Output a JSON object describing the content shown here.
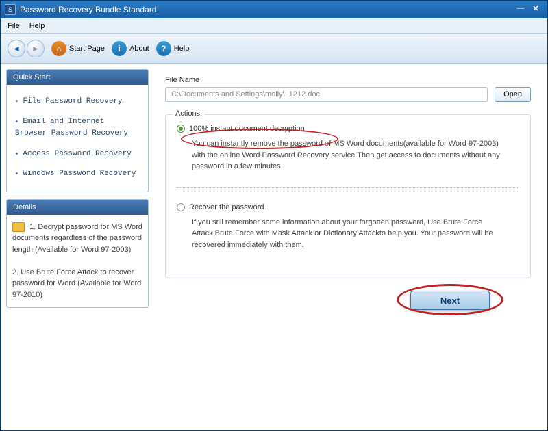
{
  "titlebar": {
    "title": "Password Recovery Bundle Standard",
    "icon_text": "S"
  },
  "menu": {
    "file": "File",
    "help": "Help"
  },
  "toolbar": {
    "back_glyph": "◄",
    "fwd_glyph": "►",
    "start_page": "Start Page",
    "about": "About",
    "help": "Help",
    "home_glyph": "⌂",
    "info_glyph": "i",
    "help_glyph": "?"
  },
  "sidebar": {
    "quick_start_title": "Quick Start",
    "items": [
      "File Password Recovery",
      "Email and Internet Browser Password Recovery",
      "Access Password Recovery",
      "Windows Password Recovery"
    ],
    "details_title": "Details",
    "details_text_1": "1. Decrypt password for MS Word documents regardless of the password length.(Available for Word 97-2003)",
    "details_text_2": "2. Use Brute Force Attack to recover password for Word (Available for Word 97-2010)"
  },
  "main": {
    "file_name_label": "File Name",
    "file_path": "C:\\Documents and Settings\\molly\\  1212.doc",
    "open_btn": "Open",
    "actions_label": "Actions:",
    "option1": {
      "label": "100% instant document decryption",
      "desc": "You can instantly remove the password of MS Word documents(available for Word 97-2003) with the online Word Password Recovery service.Then get access to documents without any password in a few minutes"
    },
    "option2": {
      "label": "Recover the password",
      "desc": "If you still remember some information about your forgotten password, Use Brute Force Attack,Brute Force with Mask Attack or Dictionary Attackto help you. Your password will be recovered immediately with them."
    },
    "next_btn": "Next"
  }
}
